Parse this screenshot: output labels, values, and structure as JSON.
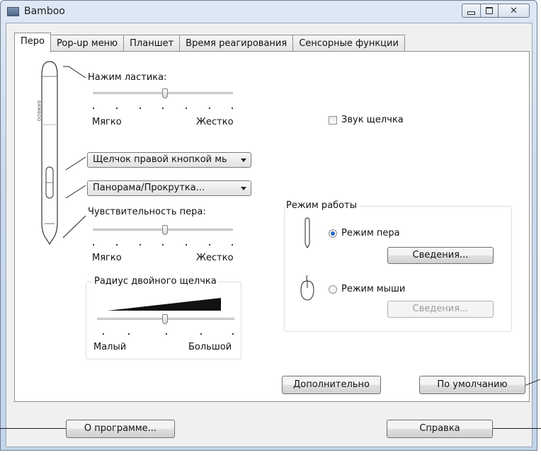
{
  "window": {
    "title": "Bamboo"
  },
  "tabs": [
    {
      "label": "Перо",
      "active": true
    },
    {
      "label": "Pop-up меню"
    },
    {
      "label": "Планшет"
    },
    {
      "label": "Время реагирования"
    },
    {
      "label": "Сенсорные функции"
    }
  ],
  "eraser": {
    "label": "Нажим ластика:",
    "min_label": "Мягко",
    "max_label": "Жестко",
    "level": 0.5
  },
  "click_sound": {
    "label": "Звук щелчка",
    "checked": false
  },
  "button_upper": {
    "value": "Щелчок правой кнопкой мь"
  },
  "button_lower": {
    "value": "Панорама/Прокрутка..."
  },
  "pen_sensitivity": {
    "label": "Чувствительность пера:",
    "min_label": "Мягко",
    "max_label": "Жестко",
    "level": 0.5
  },
  "double_click": {
    "title": "Радиус двойного щелчка",
    "min_label": "Малый",
    "max_label": "Большой",
    "level": 0.5
  },
  "mode": {
    "title": "Режим работы",
    "pen_mode_label": "Режим пера",
    "pen_details_label": "Сведения...",
    "mouse_mode_label": "Режим мыши",
    "mouse_details_label": "Сведения...",
    "selected": "pen"
  },
  "buttons": {
    "advanced": "Дополнительно",
    "defaults": "По умолчанию",
    "about": "О программе...",
    "help": "Справка"
  },
  "pen_body_text": "BAMBOO",
  "colors": {
    "radio_selected": "#2e6cc7",
    "titlebar": "#cad9ec"
  }
}
